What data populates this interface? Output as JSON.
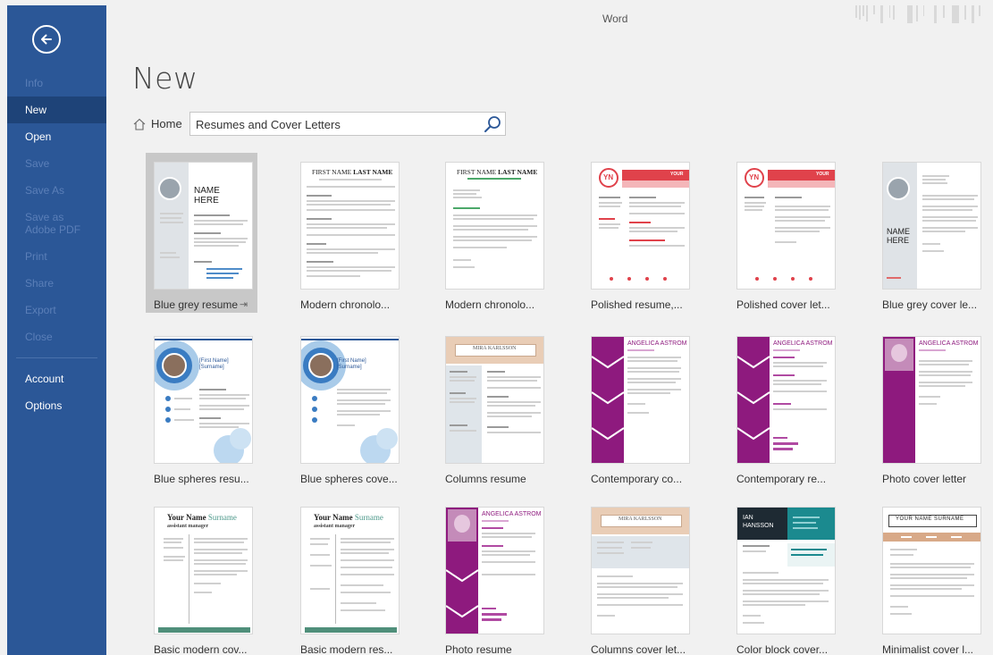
{
  "app": {
    "title": "Word"
  },
  "sidebar": {
    "items": [
      {
        "label": "Info",
        "state": "disabled"
      },
      {
        "label": "New",
        "state": "selected"
      },
      {
        "label": "Open",
        "state": "normal"
      },
      {
        "label": "Save",
        "state": "disabled"
      },
      {
        "label": "Save As",
        "state": "disabled"
      },
      {
        "label": "Save as Adobe PDF",
        "state": "disabled"
      },
      {
        "label": "Print",
        "state": "disabled"
      },
      {
        "label": "Share",
        "state": "disabled"
      },
      {
        "label": "Export",
        "state": "disabled"
      },
      {
        "label": "Close",
        "state": "disabled"
      }
    ],
    "bottom_items": [
      {
        "label": "Account"
      },
      {
        "label": "Options"
      }
    ]
  },
  "page": {
    "title": "New",
    "home_label": "Home",
    "search_value": "Resumes and Cover Letters"
  },
  "thumb_text": {
    "name": "NAME",
    "here": "HERE",
    "first_last": "FIRST NAME",
    "last_name": "LAST NAME",
    "yn": "YN",
    "your_name": "Your Name",
    "surname": "Surname",
    "angelica": "ANGELICA ASTROM",
    "mira": "MIRA KARLSSON",
    "ian": "IAN",
    "hansson": "HANSSON",
    "your_name_surname": "YOUR NAME SURNAME",
    "first_name_br": "[First Name]",
    "surname_br": "[Surname]",
    "assistant_manager": "assistant manager",
    "your": "YOUR"
  },
  "templates": [
    {
      "label": "Blue grey resume",
      "pinned": true,
      "selected": true
    },
    {
      "label": "Modern chronolo..."
    },
    {
      "label": "Modern chronolo..."
    },
    {
      "label": "Polished resume,..."
    },
    {
      "label": "Polished cover let..."
    },
    {
      "label": "Blue grey cover le..."
    },
    {
      "label": "Blue spheres resu..."
    },
    {
      "label": "Blue spheres cove..."
    },
    {
      "label": "Columns resume"
    },
    {
      "label": "Contemporary co..."
    },
    {
      "label": "Contemporary re..."
    },
    {
      "label": "Photo cover letter"
    },
    {
      "label": "Basic modern cov..."
    },
    {
      "label": "Basic modern res..."
    },
    {
      "label": "Photo resume"
    },
    {
      "label": "Columns cover let..."
    },
    {
      "label": "Color block cover..."
    },
    {
      "label": "Minimalist cover l..."
    }
  ],
  "colors": {
    "sidebar": "#2b5797",
    "sidebar_selected": "#1e4378",
    "accent_purple": "#8e1a7e",
    "accent_red": "#e0424b",
    "accent_teal": "#1b8a8f",
    "accent_blue": "#3a7cc2",
    "accent_tan": "#d8a988"
  }
}
